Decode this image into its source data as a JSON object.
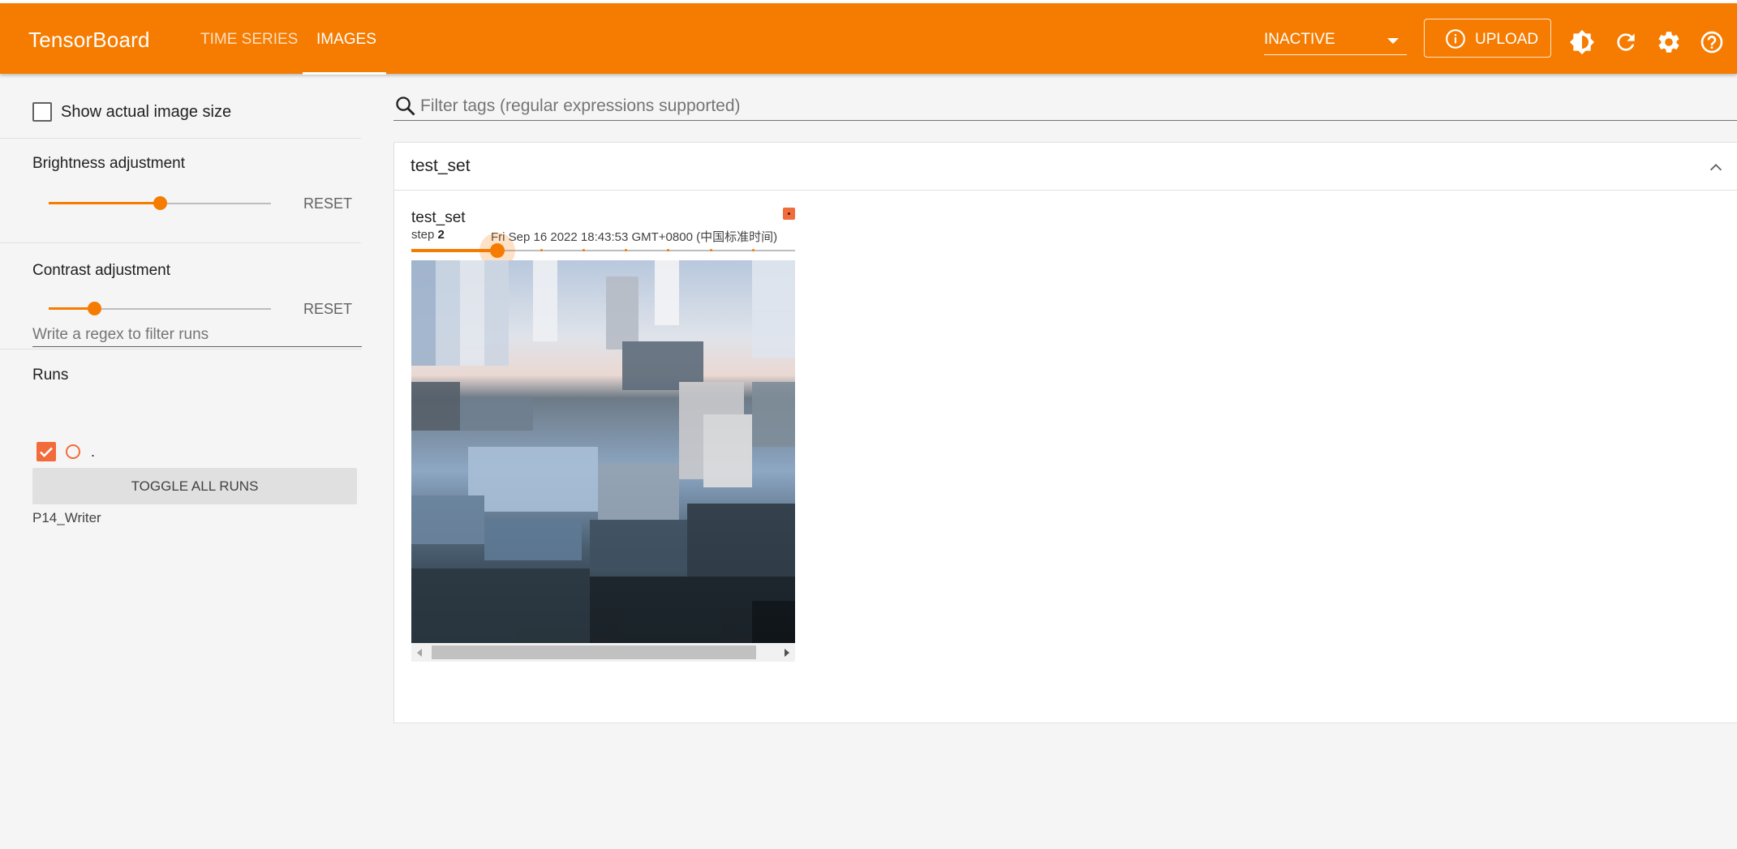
{
  "header": {
    "brand": "TensorBoard",
    "tabs": [
      {
        "label": "TIME SERIES",
        "active": false
      },
      {
        "label": "IMAGES",
        "active": true
      }
    ],
    "status_select": "INACTIVE",
    "upload_label": "UPLOAD",
    "icons": [
      "info-icon",
      "theme-toggle-icon",
      "refresh-icon",
      "settings-icon",
      "help-icon"
    ],
    "color": "#f57c00"
  },
  "sidebar": {
    "actual_size_label": "Show actual image size",
    "actual_size_checked": false,
    "brightness": {
      "title": "Brightness adjustment",
      "value": 0.5,
      "reset": "RESET"
    },
    "contrast": {
      "title": "Contrast adjustment",
      "value": 0.2,
      "reset": "RESET"
    },
    "runs": {
      "title": "Runs",
      "filter_placeholder": "Write a regex to filter runs",
      "items": [
        {
          "name": ".",
          "checked": true,
          "color": "#f26b3a"
        }
      ],
      "toggle_all_label": "TOGGLE ALL RUNS",
      "writer_label": "P14_Writer"
    }
  },
  "main": {
    "filter_placeholder": "Filter tags (regular expressions supported)",
    "card": {
      "title": "test_set",
      "image": {
        "tag": "test_set",
        "step_prefix": "step",
        "step": "2",
        "timestamp": "Fri Sep 16 2022 18:43:53 GMT+0800 (中国标准时间)",
        "step_position": 0.22
      }
    }
  }
}
